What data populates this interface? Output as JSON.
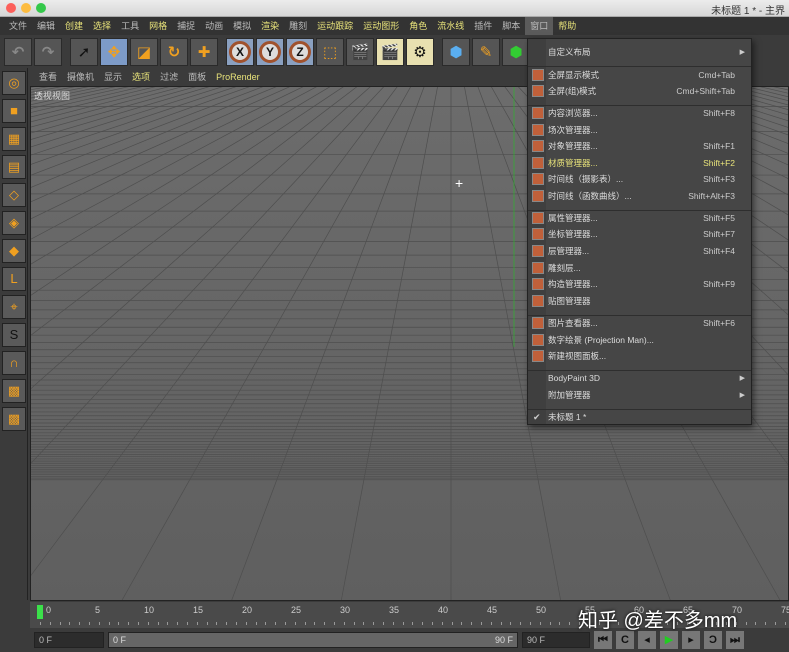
{
  "window": {
    "title": "未标题 1 * - 主界"
  },
  "menubar": [
    "文件",
    "编辑",
    "创建",
    "选择",
    "工具",
    "网格",
    "捕捉",
    "动画",
    "模拟",
    "渲染",
    "雕刻",
    "运动跟踪",
    "运动图形",
    "角色",
    "流水线",
    "插件",
    "脚本",
    "窗口",
    "帮助"
  ],
  "viewport_menu": [
    "查看",
    "摄像机",
    "显示",
    "选项",
    "过滤",
    "面板",
    "ProRender"
  ],
  "viewport_label": "透视视图",
  "toolbar": {
    "x": "X",
    "y": "Y",
    "z": "Z"
  },
  "window_menu": {
    "items": [
      {
        "label": "自定义布局",
        "submenu": true
      },
      {
        "label": "全屏显示模式",
        "shortcut": "Cmd+Tab"
      },
      {
        "label": "全屏(组)模式",
        "shortcut": "Cmd+Shift+Tab"
      },
      {
        "label": "内容浏览器...",
        "shortcut": "Shift+F8"
      },
      {
        "label": "场次管理器..."
      },
      {
        "label": "对象管理器...",
        "shortcut": "Shift+F1"
      },
      {
        "label": "材质管理器...",
        "shortcut": "Shift+F2",
        "highlighted": true
      },
      {
        "label": "时间线（摄影表）...",
        "shortcut": "Shift+F3"
      },
      {
        "label": "时间线（函数曲线）...",
        "shortcut": "Shift+Alt+F3"
      },
      {
        "label": "属性管理器...",
        "shortcut": "Shift+F5"
      },
      {
        "label": "坐标管理器...",
        "shortcut": "Shift+F7"
      },
      {
        "label": "层管理器...",
        "shortcut": "Shift+F4"
      },
      {
        "label": "雕刻层..."
      },
      {
        "label": "构造管理器...",
        "shortcut": "Shift+F9"
      },
      {
        "label": "贴图管理器"
      },
      {
        "label": "图片查看器...",
        "shortcut": "Shift+F6"
      },
      {
        "label": "数字绘景 (Projection Man)..."
      },
      {
        "label": "新建视图面板..."
      },
      {
        "label": "BodyPaint 3D",
        "submenu": true
      },
      {
        "label": "附加管理器",
        "submenu": true
      },
      {
        "label": "未标题 1 *",
        "checked": true
      }
    ]
  },
  "timeline": {
    "ticks": [
      "0",
      "5",
      "10",
      "15",
      "20",
      "25",
      "30",
      "35",
      "40",
      "45",
      "50",
      "55",
      "60",
      "65",
      "70",
      "75"
    ]
  },
  "controls": {
    "start": "0 F",
    "range_start": "0 F",
    "range_end": "90 F",
    "end": "90 F"
  },
  "watermark": "知乎 @差不多mm",
  "colors": {
    "highlight": "#e8e37a",
    "menu_bg": "#464646",
    "viewport": "#666666"
  }
}
